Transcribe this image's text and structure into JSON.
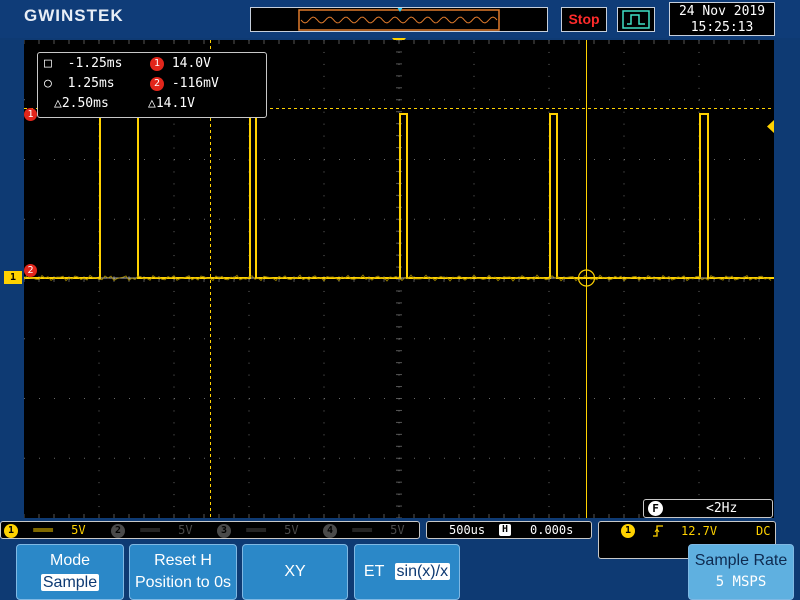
{
  "header": {
    "logo_text": "GWINSTEK",
    "run_state": "Stop",
    "date": "24 Nov 2019",
    "time": "15:25:13"
  },
  "cursors": {
    "t1": "-1.25ms",
    "t2": "1.25ms",
    "dt": "△2.50ms",
    "v1": "14.0V",
    "v2": "-116mV",
    "dv": "△14.1V"
  },
  "frequency": {
    "label": "F",
    "value": "<2Hz"
  },
  "channels": [
    {
      "num": "1",
      "coupling": "DC",
      "scale": "5V",
      "active": true
    },
    {
      "num": "2",
      "scale": "5V",
      "active": false
    },
    {
      "num": "3",
      "scale": "5V",
      "active": false
    },
    {
      "num": "4",
      "scale": "5V",
      "active": false
    }
  ],
  "timebase": {
    "scale": "500us",
    "h_icon": "H",
    "position": "0.000s"
  },
  "trigger": {
    "source": "1",
    "slope_icon": "rising-edge-icon",
    "level": "12.7V",
    "coupling": "DC"
  },
  "markers": {
    "ch1_ground": "1",
    "cursor1_marker": "1",
    "cursor2_marker": "2"
  },
  "softkeys": [
    {
      "line1": "Mode",
      "line2": "Sample"
    },
    {
      "line1": "Reset H",
      "line2": "Position to 0s"
    },
    {
      "line1": "XY",
      "line2": ""
    },
    {
      "line1": "ET",
      "line2": "sin(x)/x"
    },
    {
      "line1": "Sample Rate",
      "line2": "5 MSPS"
    }
  ],
  "colors": {
    "screen_bg": "#000000",
    "ui_blue": "#0e3a73",
    "softkey_blue": "#2b88c8",
    "trace_yellow": "#ffd200",
    "stop_red": "#ff2b2b",
    "trigger_orange": "#e07b2c"
  }
}
